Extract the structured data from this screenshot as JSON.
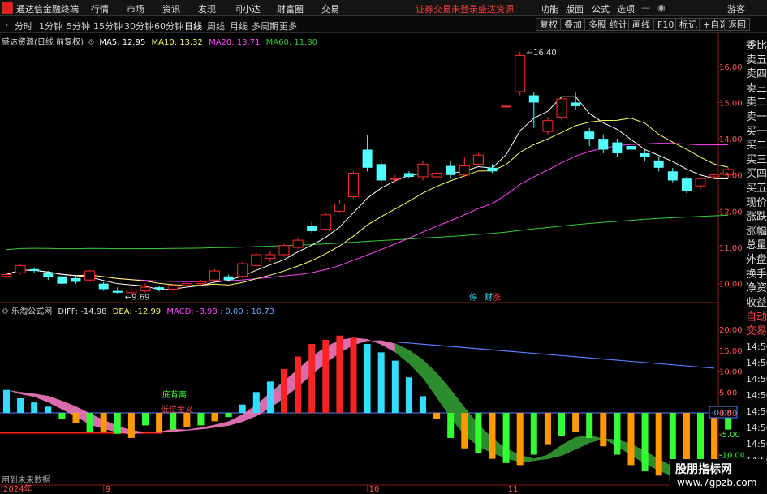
{
  "app": {
    "title": "通达信金融终端"
  },
  "menu": {
    "items": [
      "行情",
      "市场",
      "资讯",
      "发现",
      "问小达",
      "财富圈",
      "交易"
    ],
    "status": "证券交易未登录",
    "stock_name": "盛达资源",
    "right_items": [
      "功能",
      "版面",
      "公式",
      "选项"
    ],
    "user": "游客"
  },
  "periods": {
    "items": [
      "分时",
      "1分钟",
      "5分钟",
      "15分钟",
      "30分钟",
      "60分钟",
      "日线",
      "周线",
      "月线",
      "多周期",
      "更多"
    ],
    "active": "日线"
  },
  "toolbar": {
    "buttons": [
      "复权",
      "叠加",
      "多股",
      "统计",
      "画线",
      "F10",
      "标记",
      "+自选",
      "返回"
    ]
  },
  "main_info": {
    "title": "盛达资源(日线 前复权)",
    "ma5": "MA5: 12.95",
    "ma10": "MA10: 13.32",
    "ma20": "MA20: 13.71",
    "ma60": "MA60: 11.80",
    "high_label": "16.40",
    "low_label": "9.69",
    "tag1": "停",
    "tag2": "财",
    "tag3": "涨"
  },
  "sub_info": {
    "title": "乐淘公式网",
    "diff": "DIFF: -14.98",
    "dea": "DEA: -12.99",
    "macd": "MACD: -3.98",
    "extra": ": 0.00 : 10.73",
    "label_bottom": "底背离",
    "label_low": "低位金叉",
    "current": "-0.08"
  },
  "price_axis": [
    "16.00",
    "15.00",
    "14.00",
    "13.00",
    "12.00",
    "11.00",
    "10.00"
  ],
  "macd_axis": [
    "20.00",
    "15.00",
    "10.00",
    "5.00",
    "0.00",
    "-5.00",
    "-10.00"
  ],
  "date_axis": [
    "2024年",
    "9",
    "10",
    "11"
  ],
  "sidebar": {
    "top": [
      "委比",
      "卖五",
      "卖四",
      "卖三",
      "卖二",
      "卖一",
      "买一",
      "买二",
      "买三",
      "买四",
      "买五",
      "现价",
      "涨跌",
      "涨幅",
      "总量",
      "外盘",
      "换手",
      "净资",
      "收益"
    ],
    "bottom_label": "自动交易",
    "times": [
      "14:56",
      "14:56",
      "14:56",
      "14:56",
      "14:56",
      "14:56",
      "14:56",
      "14:56"
    ]
  },
  "footer": {
    "future": "用到未来数据"
  },
  "watermark": {
    "line1": "股朋指标网",
    "line2": "www.7gpzb.com"
  },
  "colors": {
    "up": "#ff2b2b",
    "down": "#54ffff",
    "ma5": "#ffffff",
    "ma10": "#ffff66",
    "ma20": "#ff44ff",
    "ma60": "#33cc33",
    "diff": "#ff88cc",
    "dea": "#2d8c2d",
    "macd_pos": "#ff2222",
    "macd_neg_weak": "#33ff33",
    "macd_neg_strong": "#ff9900",
    "macd_cyan": "#33ddff"
  },
  "chart_data": {
    "type": "line",
    "price_range": [
      9.5,
      16.6
    ],
    "candles": [
      [
        10.2,
        10.25,
        10.28,
        10.15
      ],
      [
        10.3,
        10.5,
        10.55,
        10.25
      ],
      [
        10.4,
        10.35,
        10.45,
        10.3
      ],
      [
        10.3,
        10.18,
        10.35,
        10.1
      ],
      [
        10.2,
        10.0,
        10.25,
        9.95
      ],
      [
        10.15,
        10.05,
        10.2,
        10.0
      ],
      [
        10.1,
        10.35,
        10.38,
        10.05
      ],
      [
        10.0,
        9.85,
        10.05,
        9.8
      ],
      [
        9.8,
        9.75,
        9.9,
        9.7
      ],
      [
        9.75,
        9.82,
        9.9,
        9.69
      ],
      [
        9.8,
        9.9,
        10.0,
        9.75
      ],
      [
        9.9,
        9.85,
        9.95,
        9.78
      ],
      [
        9.85,
        9.95,
        10.0,
        9.8
      ],
      [
        9.95,
        10.0,
        10.1,
        9.9
      ],
      [
        10.0,
        10.05,
        10.1,
        9.95
      ],
      [
        10.1,
        10.35,
        10.4,
        10.05
      ],
      [
        10.2,
        10.1,
        10.25,
        10.05
      ],
      [
        10.2,
        10.55,
        10.6,
        10.15
      ],
      [
        10.5,
        10.8,
        10.85,
        10.45
      ],
      [
        10.7,
        10.8,
        10.9,
        10.6
      ],
      [
        10.8,
        11.05,
        11.1,
        10.75
      ],
      [
        11.0,
        11.2,
        11.25,
        10.95
      ],
      [
        11.6,
        11.45,
        11.7,
        11.4
      ],
      [
        11.5,
        11.9,
        11.95,
        11.45
      ],
      [
        12.0,
        12.2,
        12.3,
        11.95
      ],
      [
        12.4,
        13.05,
        13.1,
        12.35
      ],
      [
        13.7,
        13.2,
        14.1,
        13.1
      ],
      [
        13.3,
        12.85,
        13.4,
        12.8
      ],
      [
        12.9,
        12.9,
        13.0,
        12.8
      ],
      [
        13.05,
        12.95,
        13.1,
        12.9
      ],
      [
        12.95,
        13.3,
        13.4,
        12.85
      ],
      [
        12.95,
        13.05,
        13.1,
        12.9
      ],
      [
        13.25,
        13.0,
        13.4,
        12.9
      ],
      [
        13.0,
        13.25,
        13.5,
        12.95
      ],
      [
        13.3,
        13.55,
        13.6,
        13.25
      ],
      [
        13.2,
        13.1,
        13.3,
        13.05
      ],
      [
        14.9,
        14.9,
        15.0,
        14.85
      ],
      [
        15.3,
        16.3,
        16.4,
        15.2
      ],
      [
        15.2,
        15.0,
        15.3,
        14.3
      ],
      [
        14.2,
        14.5,
        14.6,
        14.1
      ],
      [
        14.6,
        15.1,
        15.2,
        14.5
      ],
      [
        15.0,
        14.9,
        15.3,
        14.8
      ],
      [
        14.2,
        14.0,
        14.3,
        13.8
      ],
      [
        14.0,
        13.7,
        14.1,
        13.6
      ],
      [
        13.9,
        13.6,
        14.0,
        13.5
      ],
      [
        13.8,
        13.7,
        13.9,
        13.6
      ],
      [
        13.6,
        13.5,
        13.7,
        13.4
      ],
      [
        13.4,
        13.2,
        13.5,
        13.1
      ],
      [
        13.1,
        12.85,
        13.2,
        12.8
      ],
      [
        12.9,
        12.55,
        12.95,
        12.5
      ],
      [
        12.7,
        12.9,
        12.95,
        12.6
      ],
      [
        12.95,
        13.0,
        13.05,
        12.9
      ],
      [
        13.0,
        13.15,
        13.2,
        12.95
      ]
    ],
    "macd": [
      5.5,
      3.5,
      2.5,
      1.5,
      -1.5,
      -2.5,
      -4.5,
      -4.5,
      -5.0,
      -6.0,
      -3.0,
      -4.5,
      -4.0,
      -3.5,
      -3.0,
      -2.0,
      -1.0,
      2.0,
      5.0,
      7.5,
      10.5,
      13.5,
      16.5,
      17.5,
      18.5,
      18.0,
      16.5,
      14.5,
      12.5,
      8.5,
      4.0,
      -1.5,
      -6.0,
      -8.5,
      -9.5,
      -11.0,
      -12.0,
      -12.5,
      -10.0,
      -7.5,
      -5.5,
      -4.5,
      -6.0,
      -8.0,
      -10.0,
      -12.5,
      -14.0,
      -15.0,
      -16.5,
      -17.5,
      -15.0,
      -13.0,
      -4.0
    ],
    "macd_axis_range": [
      -16.5,
      23.5
    ]
  }
}
